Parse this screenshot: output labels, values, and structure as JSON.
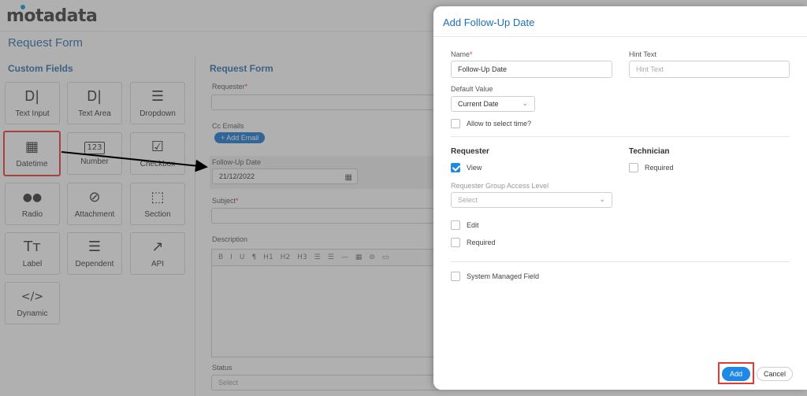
{
  "app": {
    "logo": "motadata",
    "page_title": "Request Form"
  },
  "palette": {
    "title": "Custom Fields",
    "tiles": [
      {
        "label": "Text Input",
        "icon": "text-input-icon",
        "glyph": "Ꭰ|"
      },
      {
        "label": "Text Area",
        "icon": "text-area-icon",
        "glyph": "Ꭰ|"
      },
      {
        "label": "Dropdown",
        "icon": "dropdown-icon",
        "glyph": "☰"
      },
      {
        "label": "Datetime",
        "icon": "calendar-icon",
        "glyph": "▦"
      },
      {
        "label": "Number",
        "icon": "number-icon",
        "glyph": "123"
      },
      {
        "label": "Checkbox",
        "icon": "checkbox-icon",
        "glyph": "☑"
      },
      {
        "label": "Radio",
        "icon": "radio-icon",
        "glyph": "●●"
      },
      {
        "label": "Attachment",
        "icon": "paperclip-icon",
        "glyph": "⊘"
      },
      {
        "label": "Section",
        "icon": "section-icon",
        "glyph": "⬚"
      },
      {
        "label": "Label",
        "icon": "label-icon",
        "glyph": "Tт"
      },
      {
        "label": "Dependent",
        "icon": "dependent-icon",
        "glyph": "☰"
      },
      {
        "label": "API",
        "icon": "external-link-icon",
        "glyph": "↗"
      },
      {
        "label": "Dynamic",
        "icon": "code-icon",
        "glyph": "</>"
      }
    ]
  },
  "form": {
    "title": "Request Form",
    "requester_label": "Requester",
    "cc_label": "Cc Emails",
    "add_email": "+ Add Email",
    "follow_up_label": "Follow-Up Date",
    "follow_up_value": "21/12/2022",
    "subject_label": "Subject",
    "description_label": "Description",
    "status_label": "Status",
    "status_placeholder": "Select",
    "rte_tools": [
      "B",
      "I",
      "U",
      "¶",
      "H1",
      "H2",
      "H3",
      "☰",
      "☰",
      "—",
      "▦",
      "⊘",
      "▭"
    ]
  },
  "drawer": {
    "title": "Add Follow-Up Date",
    "name_label": "Name",
    "name_value": "Follow-Up Date",
    "hint_label": "Hint Text",
    "hint_placeholder": "Hint Text",
    "default_label": "Default Value",
    "default_value": "Current Date",
    "allow_time_label": "Allow to select time?",
    "requester_heading": "Requester",
    "technician_heading": "Technician",
    "view_label": "View",
    "tech_required_label": "Required",
    "group_access_label": "Requester Group Access Level",
    "group_access_placeholder": "Select",
    "edit_label": "Edit",
    "req_required_label": "Required",
    "system_managed_label": "System Managed Field",
    "add_button": "Add",
    "cancel_button": "Cancel"
  },
  "colors": {
    "accent": "#1e88e5",
    "highlight": "#e53935",
    "title_blue": "#1e6fb5"
  }
}
